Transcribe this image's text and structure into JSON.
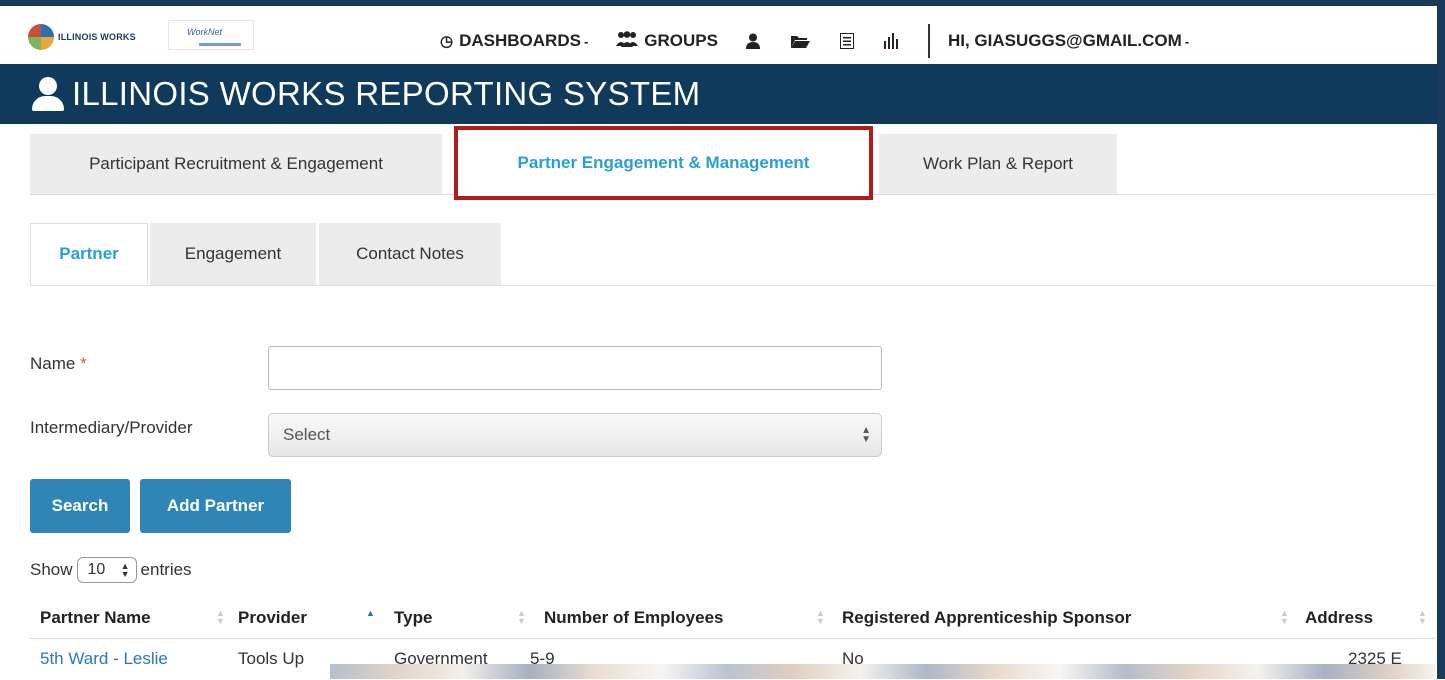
{
  "topnav": {
    "logo_text": "ILLINOIS WORKS",
    "logo2_text": "WorkNet",
    "dashboards": "DASHBOARDS",
    "groups": "GROUPS",
    "user_greeting": "HI, GIASUGGS@GMAIL.COM"
  },
  "banner": {
    "title": "ILLINOIS WORKS REPORTING SYSTEM"
  },
  "main_tabs": [
    {
      "label": "Participant Recruitment & Engagement"
    },
    {
      "label": "Partner Engagement & Management",
      "active": true
    },
    {
      "label": "Work Plan & Report"
    }
  ],
  "sub_tabs": [
    {
      "label": "Partner",
      "active": true
    },
    {
      "label": "Engagement"
    },
    {
      "label": "Contact Notes"
    }
  ],
  "form": {
    "name_label": "Name",
    "name_required": "*",
    "name_value": "",
    "provider_label": "Intermediary/Provider",
    "provider_selected": "Select"
  },
  "buttons": {
    "search": "Search",
    "add_partner": "Add Partner"
  },
  "entries": {
    "show": "Show",
    "value": "10",
    "suffix": "entries"
  },
  "table": {
    "columns": [
      "Partner Name",
      "Provider",
      "Type",
      "Number of Employees",
      "Registered Apprenticeship Sponsor",
      "Address"
    ],
    "rows": [
      [
        "5th Ward - Leslie",
        "Tools Up",
        "Government",
        "5-9",
        "No",
        "2325 E"
      ]
    ]
  },
  "colors": {
    "banner": "#0f3a5c",
    "accent": "#2a9fd6",
    "button": "#2f86b6",
    "highlight_border": "#b31b1b"
  },
  "icons": [
    "clock-icon",
    "groups-icon",
    "user-icon",
    "folder-icon",
    "list-icon",
    "bar-chart-icon",
    "user-icon",
    "sort-icon"
  ]
}
